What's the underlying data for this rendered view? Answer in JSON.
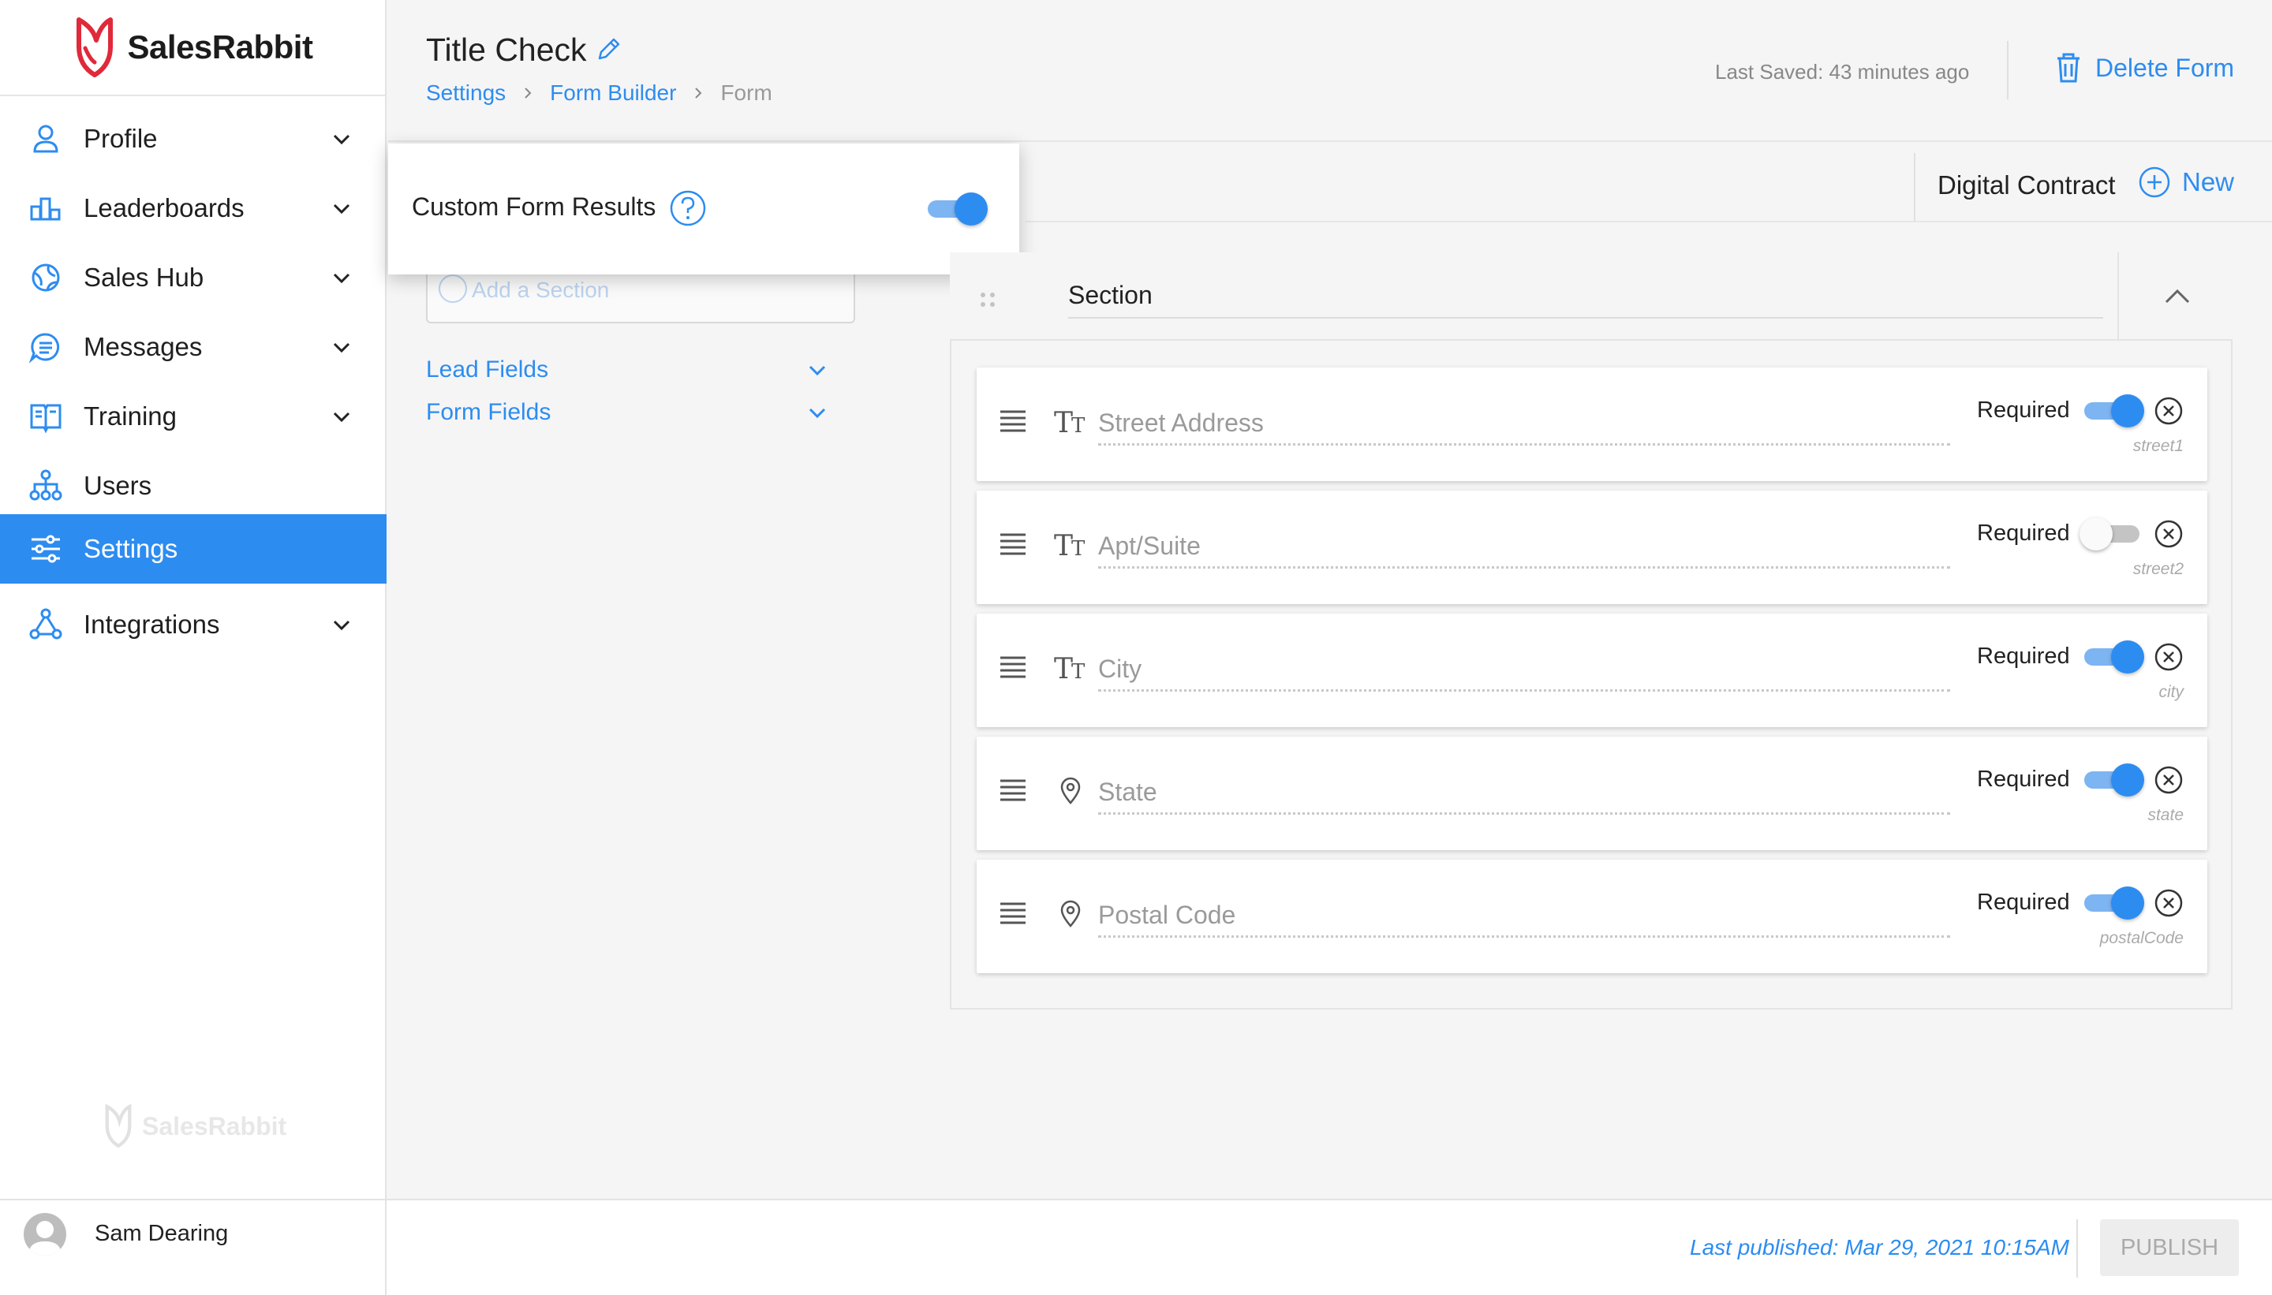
{
  "brand": {
    "name": "SalesRabbit",
    "accent": "#2d8cf0",
    "logo_red": "#e0293a"
  },
  "sidebar": {
    "items": [
      {
        "label": "Profile",
        "icon": "person-icon",
        "expandable": true,
        "active": false
      },
      {
        "label": "Leaderboards",
        "icon": "leaderboard-icon",
        "expandable": true,
        "active": false
      },
      {
        "label": "Sales Hub",
        "icon": "globe-icon",
        "expandable": true,
        "active": false
      },
      {
        "label": "Messages",
        "icon": "chat-icon",
        "expandable": true,
        "active": false
      },
      {
        "label": "Training",
        "icon": "book-icon",
        "expandable": true,
        "active": false
      },
      {
        "label": "Users",
        "icon": "org-chart-icon",
        "expandable": false,
        "active": false
      },
      {
        "label": "Settings",
        "icon": "sliders-icon",
        "expandable": false,
        "active": true
      },
      {
        "label": "Integrations",
        "icon": "integrations-icon",
        "expandable": true,
        "active": false
      }
    ],
    "watermark": "SalesRabbit"
  },
  "header": {
    "title": "Title Check",
    "breadcrumb": {
      "settings": "Settings",
      "form_builder": "Form Builder",
      "current": "Form"
    },
    "last_saved": "Last Saved:  43 minutes ago",
    "delete_label": "Delete Form"
  },
  "contract_bar": {
    "name": "Digital Contract",
    "new_label": "New"
  },
  "popup": {
    "label": "Custom Form Results",
    "toggle_on": true
  },
  "left_panel": {
    "add_section_placeholder": "Add a Section",
    "groups": [
      {
        "label": "Lead Fields"
      },
      {
        "label": "Form Fields"
      }
    ]
  },
  "section": {
    "title": "Section",
    "fields": [
      {
        "label": "Street Address",
        "key": "street1",
        "type_icon": "text-type-icon",
        "required_label": "Required",
        "required": true
      },
      {
        "label": "Apt/Suite",
        "key": "street2",
        "type_icon": "text-type-icon",
        "required_label": "Required",
        "required": false
      },
      {
        "label": "City",
        "key": "city",
        "type_icon": "text-type-icon",
        "required_label": "Required",
        "required": true
      },
      {
        "label": "State",
        "key": "state",
        "type_icon": "location-pin-icon",
        "required_label": "Required",
        "required": true
      },
      {
        "label": "Postal Code",
        "key": "postalCode",
        "type_icon": "location-pin-icon",
        "required_label": "Required",
        "required": true
      }
    ]
  },
  "footer": {
    "user_name": "Sam Dearing",
    "last_published": "Last published: Mar 29, 2021 10:15AM",
    "publish_label": "PUBLISH"
  }
}
